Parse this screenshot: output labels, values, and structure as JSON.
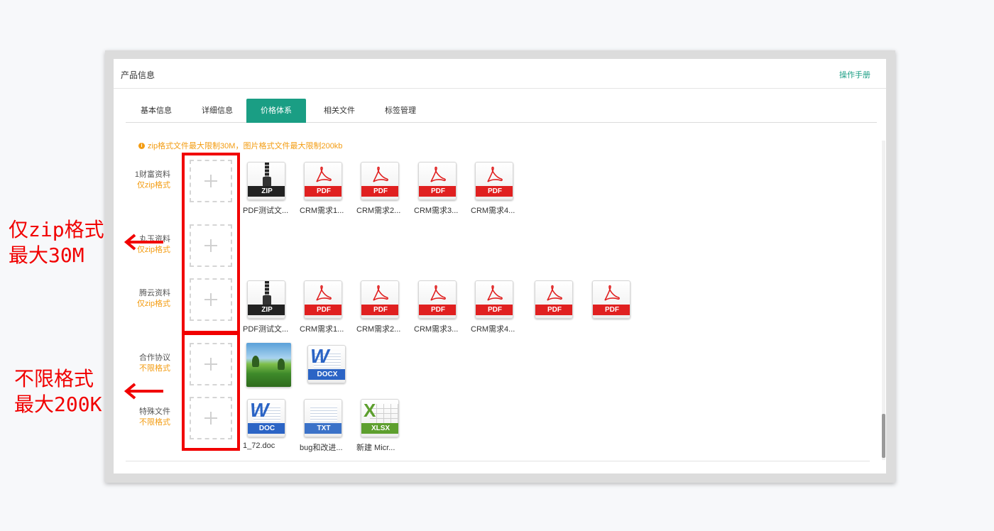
{
  "panel": {
    "title": "产品信息",
    "manual_link": "操作手册"
  },
  "tabs": [
    {
      "label": "基本信息"
    },
    {
      "label": "详细信息"
    },
    {
      "label": "价格体系"
    },
    {
      "label": "相关文件"
    },
    {
      "label": "标签管理"
    }
  ],
  "active_tab": "价格体系",
  "notice": "zip格式文件最大限制30M，图片格式文件最大限制200kb",
  "rows": [
    {
      "name": "1财富资料",
      "restriction": "仅zip格式"
    },
    {
      "name": "丸玉资料",
      "restriction": "仅zip格式"
    },
    {
      "name": "腾云资料",
      "restriction": "仅zip格式"
    },
    {
      "name": "合作协议",
      "restriction": "不限格式"
    },
    {
      "name": "特殊文件",
      "restriction": "不限格式"
    }
  ],
  "files": {
    "row1": [
      {
        "type": "ZIP",
        "name": "PDF测试文..."
      },
      {
        "type": "PDF",
        "name": "CRM需求1..."
      },
      {
        "type": "PDF",
        "name": "CRM需求2..."
      },
      {
        "type": "PDF",
        "name": "CRM需求3..."
      },
      {
        "type": "PDF",
        "name": "CRM需求4..."
      }
    ],
    "row3": [
      {
        "type": "ZIP",
        "name": "PDF测试文..."
      },
      {
        "type": "PDF",
        "name": "CRM需求1..."
      },
      {
        "type": "PDF",
        "name": "CRM需求2..."
      },
      {
        "type": "PDF",
        "name": "CRM需求3..."
      },
      {
        "type": "PDF",
        "name": "CRM需求4..."
      },
      {
        "type": "PDF",
        "name": ""
      },
      {
        "type": "PDF",
        "name": ""
      }
    ],
    "row4": [
      {
        "type": "image",
        "name": ""
      },
      {
        "type": "DOCX",
        "name": ""
      }
    ],
    "row5": [
      {
        "type": "DOC",
        "name": "1_72.doc"
      },
      {
        "type": "TXT",
        "name": "bug和改进..."
      },
      {
        "type": "XLSX",
        "name": "新建 Micr..."
      }
    ]
  },
  "annotations": {
    "top": [
      "仅zip格式",
      "最大30M"
    ],
    "bottom": [
      "不限格式",
      "最大200K"
    ]
  },
  "colors": {
    "accent": "#1a9e84",
    "warning": "#f39c12",
    "annotation": "#f10000",
    "pdf": "#e02020",
    "zip": "#222222",
    "word": "#2b64c5",
    "excel": "#5d9f2e"
  }
}
